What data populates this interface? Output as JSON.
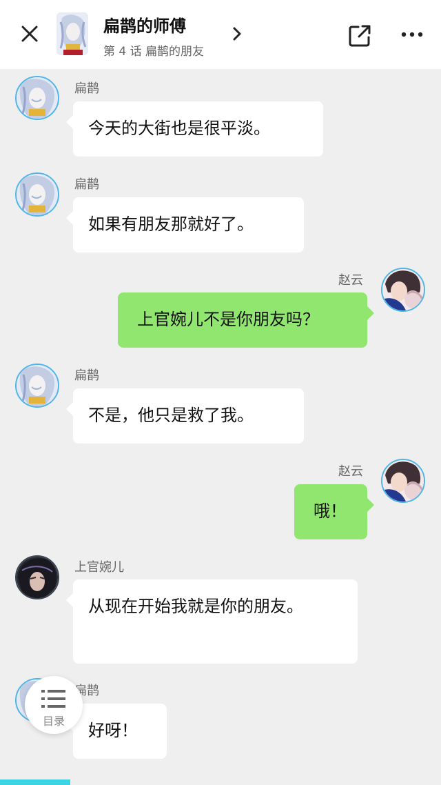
{
  "header": {
    "title": "扁鹊的师傅",
    "subtitle": "第 4 话 扁鹊的朋友",
    "close_icon": "close-icon",
    "share_icon": "share-icon",
    "more_icon": "more-icon"
  },
  "messages": [
    {
      "name": "扁鹊",
      "text": "今天的大街也是很平淡。"
    },
    {
      "name": "扁鹊",
      "text": "如果有朋友那就好了。"
    },
    {
      "name": "赵云",
      "text": "上官婉儿不是你朋友吗？"
    },
    {
      "name": "扁鹊",
      "text": "不是，他只是救了我。"
    },
    {
      "name": "赵云",
      "text": "哦！"
    },
    {
      "name": "上官婉儿",
      "text": "从现在开始我就是你的朋友。"
    },
    {
      "name": "扁鹊",
      "text": "好呀！"
    }
  ],
  "toc": {
    "label": "目录",
    "icon": "list-icon"
  },
  "progress": {
    "fraction": 0.16,
    "color": "#3cd3e3"
  },
  "colors": {
    "left_bubble": "#ffffff",
    "right_bubble": "#90e66e",
    "avatar_border": "#4eb6e8"
  }
}
